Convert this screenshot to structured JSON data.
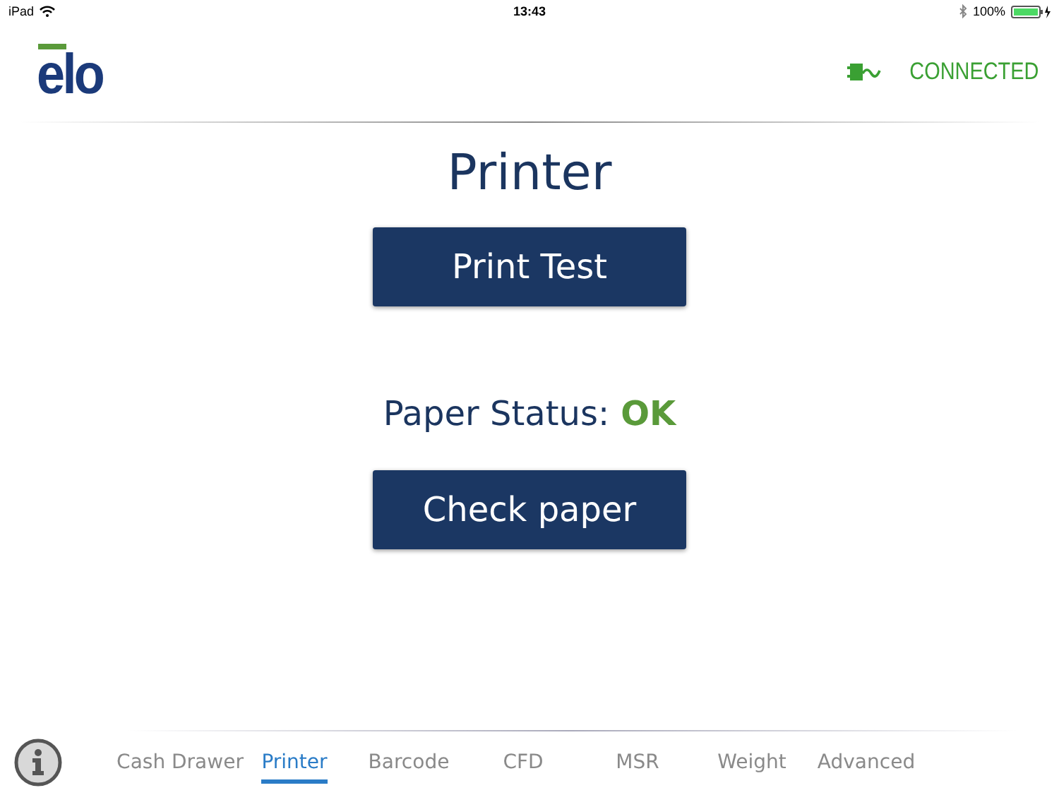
{
  "status_bar": {
    "device": "iPad",
    "time": "13:43",
    "battery": "100%"
  },
  "header": {
    "logo": "elo",
    "connection": "CONNECTED"
  },
  "title": "Printer",
  "print_button": "Print Test",
  "paper_status": {
    "label": "Paper Status:",
    "value": "OK"
  },
  "check_button": "Check paper",
  "tabs": [
    {
      "label": "Cash Drawer",
      "selected": false
    },
    {
      "label": "Printer",
      "selected": true
    },
    {
      "label": "Barcode",
      "selected": false
    },
    {
      "label": "CFD",
      "selected": false
    },
    {
      "label": "MSR",
      "selected": false
    },
    {
      "label": "Weight",
      "selected": false
    },
    {
      "label": "Advanced",
      "selected": false
    }
  ]
}
